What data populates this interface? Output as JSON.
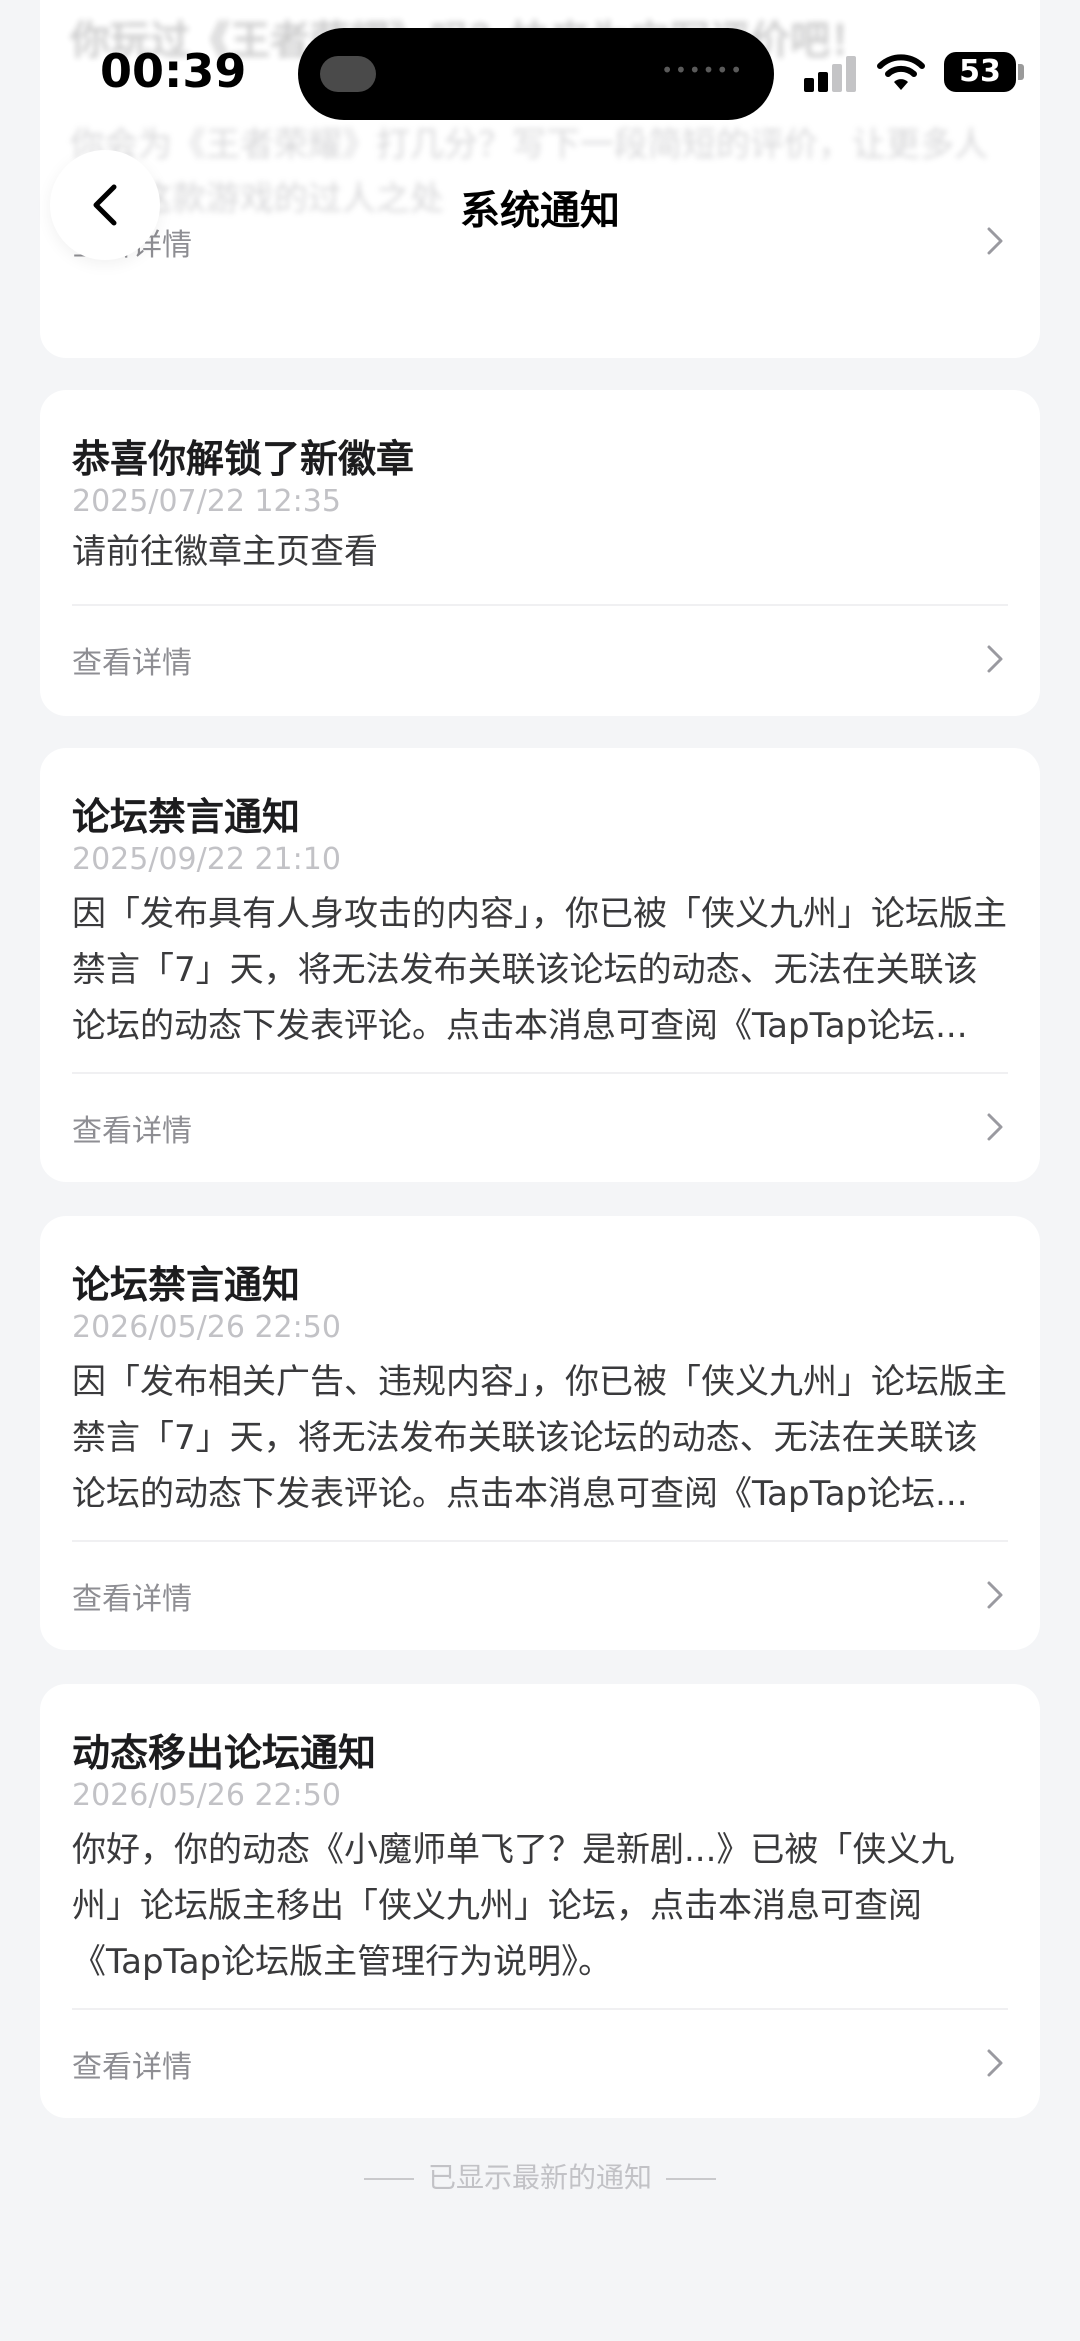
{
  "status_bar": {
    "time": "00:39",
    "battery": "53"
  },
  "background_card": {
    "title": "你玩过《王者荣耀》吗？快来为它写评价吧！",
    "subtitle_line1": "你会为《王者荣耀》打几分？写下一段简短的评价，让更多人",
    "subtitle_line2": "了解这款游戏的过人之处",
    "link_label": "查看详情"
  },
  "header": {
    "back_icon": "chevron-left-icon",
    "title": "系统通知"
  },
  "notifications": [
    {
      "title": "恭喜你解锁了新徽章",
      "date": "2025/07/22 12:35",
      "body": [
        "请前往徽章主页查看"
      ],
      "link_label": "查看详情"
    },
    {
      "title": "论坛禁言通知",
      "date": "2025/09/22 21:10",
      "body": [
        "因「发布具有人身攻击的内容」，你已被「侠义九州」论坛版主",
        "禁言「7」天，将无法发布关联该论坛的动态、无法在关联该",
        "论坛的动态下发表评论。点击本消息可查阅《TapTap论坛..."
      ],
      "link_label": "查看详情"
    },
    {
      "title": "论坛禁言通知",
      "date": "2026/05/26 22:50",
      "body": [
        "因「发布相关广告、违规内容」，你已被「侠义九州」论坛版主",
        "禁言「7」天，将无法发布关联该论坛的动态、无法在关联该",
        "论坛的动态下发表评论。点击本消息可查阅《TapTap论坛..."
      ],
      "link_label": "查看详情"
    },
    {
      "title": "动态移出论坛通知",
      "date": "2026/05/26 22:50",
      "body": [
        "你好，你的动态《小魔师单飞了？是新剧...》已被「侠义九",
        "州」论坛版主移出「侠义九州」论坛，点击本消息可查阅",
        "《TapTap论坛版主管理行为说明》。"
      ],
      "link_label": "查看详情"
    }
  ],
  "footer": {
    "note": "已显示最新的通知"
  },
  "colors": {
    "page_background": "#f4f5f7",
    "card_background": "#ffffff",
    "title_text": "#1c1c1e",
    "muted_text": "#8e8e93",
    "date_text": "#c2c2c6"
  }
}
